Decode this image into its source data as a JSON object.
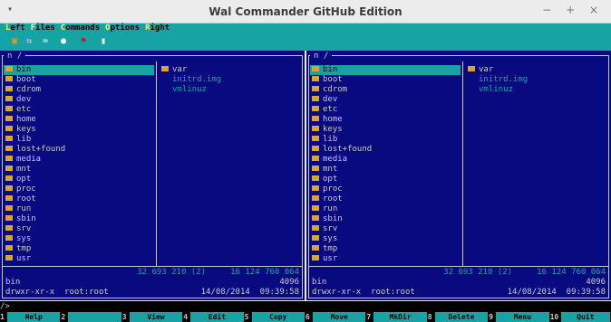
{
  "window": {
    "title": "Wal Commander GitHub Edition",
    "menu_glyph": "▾",
    "controls": "− + ×"
  },
  "menu": [
    {
      "hotkey": "L",
      "rest": "eft"
    },
    {
      "hotkey": "F",
      "rest": "iles"
    },
    {
      "hotkey": "C",
      "rest": "ommands"
    },
    {
      "hotkey": "O",
      "rest": "ptions"
    },
    {
      "hotkey": "R",
      "rest": "ight"
    }
  ],
  "toolbar": [
    {
      "icon": "terminal-icon",
      "glyph": "▣"
    },
    {
      "icon": "compare-icon",
      "glyph": "⇆"
    },
    {
      "icon": "equal-panels-icon",
      "glyph": "="
    },
    {
      "icon": "search-icon",
      "glyph": "●"
    },
    {
      "icon": "flag-icon",
      "glyph": "⚑"
    },
    {
      "icon": "ftp-icon",
      "glyph": "▮"
    }
  ],
  "panels": {
    "left": {
      "path": "n  /",
      "col1": [
        "bin",
        "boot",
        "cdrom",
        "dev",
        "etc",
        "home",
        "keys",
        "lib",
        "lost+found",
        "media",
        "mnt",
        "opt",
        "proc",
        "root",
        "run",
        "sbin",
        "srv",
        "sys",
        "tmp",
        "usr"
      ],
      "col2_dirs": [
        "var"
      ],
      "col2_files": [
        "initrd.img",
        "vmlinuz"
      ],
      "summary": "32 693 210 (2)     16 124 760 064",
      "name": "bin",
      "size": "4096",
      "attrs": "drwxr-xr-x  root:root",
      "date": "14/08/2014  09:39:58"
    },
    "right": {
      "path": "n  /",
      "col1": [
        "bin",
        "boot",
        "cdrom",
        "dev",
        "etc",
        "home",
        "keys",
        "lib",
        "lost+found",
        "media",
        "mnt",
        "opt",
        "proc",
        "root",
        "run",
        "sbin",
        "srv",
        "sys",
        "tmp",
        "usr"
      ],
      "col2_dirs": [
        "var"
      ],
      "col2_files": [
        "initrd.img",
        "vmlinuz"
      ],
      "summary": "32 693 210 (2)     16 124 760 064",
      "name": "bin",
      "size": "4096",
      "attrs": "drwxr-xr-x  root:root",
      "date": "14/08/2014  09:39:58"
    }
  },
  "cmdline": "/>",
  "fkeys": [
    {
      "num": "1",
      "label": "Help"
    },
    {
      "num": "2",
      "label": ""
    },
    {
      "num": "3",
      "label": "View"
    },
    {
      "num": "4",
      "label": "Edit"
    },
    {
      "num": "5",
      "label": "Copy"
    },
    {
      "num": "6",
      "label": "Move"
    },
    {
      "num": "7",
      "label": "MkDir"
    },
    {
      "num": "8",
      "label": "Delete"
    },
    {
      "num": "9",
      "label": "Menu"
    },
    {
      "num": "10",
      "label": "Quit"
    }
  ]
}
